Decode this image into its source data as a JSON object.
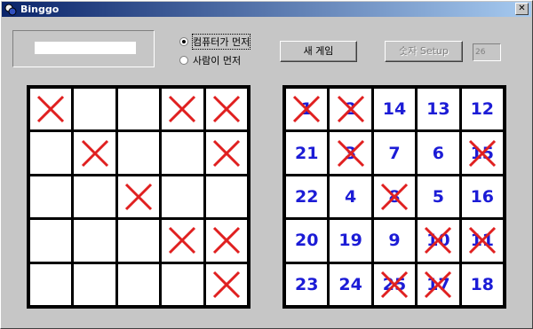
{
  "window": {
    "title": "Binggo",
    "close_label": "✕"
  },
  "status": {
    "text": ""
  },
  "mode": {
    "options": [
      {
        "label": "컴퓨터가 먼저",
        "selected": true
      },
      {
        "label": "사람이 먼저",
        "selected": false
      }
    ]
  },
  "buttons": {
    "new_game": "새 게임",
    "number_setup": "숫자 Setup"
  },
  "count_field": {
    "value": "26"
  },
  "colors": {
    "number": "#1c1cd6",
    "mark": "#e02020"
  },
  "computer_board": {
    "rows": [
      [
        {
          "number": "",
          "marked": true
        },
        {
          "number": "",
          "marked": false
        },
        {
          "number": "",
          "marked": false
        },
        {
          "number": "",
          "marked": true
        },
        {
          "number": "",
          "marked": true
        }
      ],
      [
        {
          "number": "",
          "marked": false
        },
        {
          "number": "",
          "marked": true
        },
        {
          "number": "",
          "marked": false
        },
        {
          "number": "",
          "marked": false
        },
        {
          "number": "",
          "marked": true
        }
      ],
      [
        {
          "number": "",
          "marked": false
        },
        {
          "number": "",
          "marked": false
        },
        {
          "number": "",
          "marked": true
        },
        {
          "number": "",
          "marked": false
        },
        {
          "number": "",
          "marked": false
        }
      ],
      [
        {
          "number": "",
          "marked": false
        },
        {
          "number": "",
          "marked": false
        },
        {
          "number": "",
          "marked": false
        },
        {
          "number": "",
          "marked": true
        },
        {
          "number": "",
          "marked": true
        }
      ],
      [
        {
          "number": "",
          "marked": false
        },
        {
          "number": "",
          "marked": false
        },
        {
          "number": "",
          "marked": false
        },
        {
          "number": "",
          "marked": false
        },
        {
          "number": "",
          "marked": true
        }
      ]
    ]
  },
  "player_board": {
    "rows": [
      [
        {
          "number": "1",
          "marked": true
        },
        {
          "number": "2",
          "marked": true
        },
        {
          "number": "14",
          "marked": false
        },
        {
          "number": "13",
          "marked": false
        },
        {
          "number": "12",
          "marked": false
        }
      ],
      [
        {
          "number": "21",
          "marked": false
        },
        {
          "number": "3",
          "marked": true
        },
        {
          "number": "7",
          "marked": false
        },
        {
          "number": "6",
          "marked": false
        },
        {
          "number": "15",
          "marked": true
        }
      ],
      [
        {
          "number": "22",
          "marked": false
        },
        {
          "number": "4",
          "marked": false
        },
        {
          "number": "8",
          "marked": true
        },
        {
          "number": "5",
          "marked": false
        },
        {
          "number": "16",
          "marked": false
        }
      ],
      [
        {
          "number": "20",
          "marked": false
        },
        {
          "number": "19",
          "marked": false
        },
        {
          "number": "9",
          "marked": false
        },
        {
          "number": "10",
          "marked": true
        },
        {
          "number": "11",
          "marked": true
        }
      ],
      [
        {
          "number": "23",
          "marked": false
        },
        {
          "number": "24",
          "marked": false
        },
        {
          "number": "25",
          "marked": true
        },
        {
          "number": "17",
          "marked": true
        },
        {
          "number": "18",
          "marked": false
        }
      ]
    ]
  }
}
